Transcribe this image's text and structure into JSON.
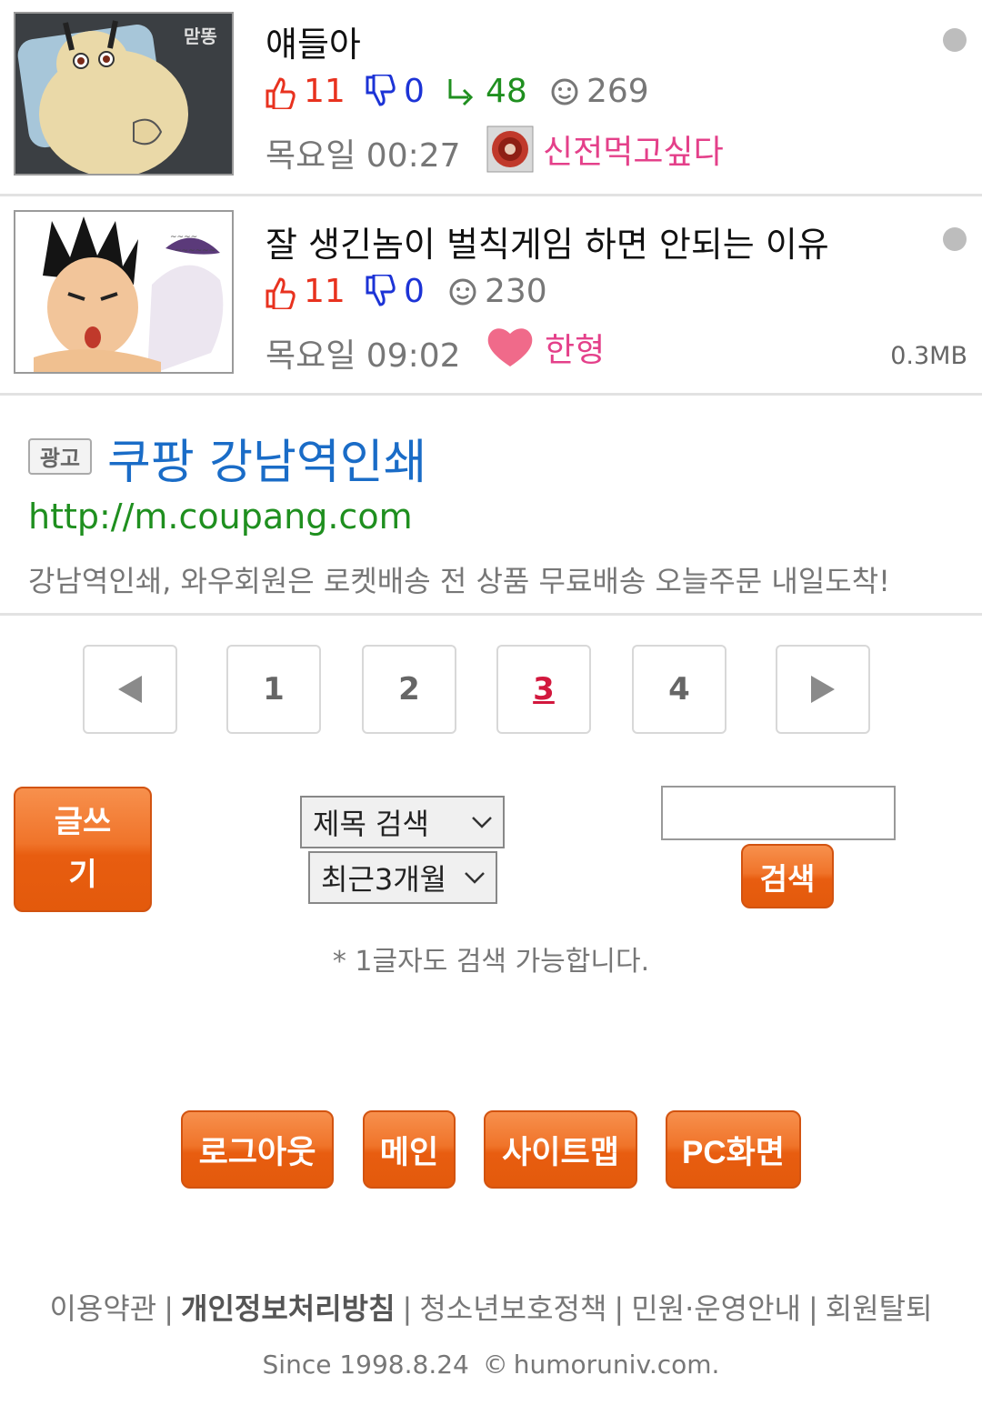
{
  "posts": [
    {
      "title": "얘들아",
      "likes": "11",
      "dislikes": "0",
      "shares": "48",
      "views": "269",
      "time": "목요일 00:27",
      "author": "신전먹고싶다",
      "thumb_text": "맏똥",
      "file_size": ""
    },
    {
      "title": "잘 생긴놈이 벌칙게임 하면 안되는 이유",
      "likes": "11",
      "dislikes": "0",
      "views": "230",
      "time": "목요일 09:02",
      "author": "한형",
      "file_size": "0.3MB"
    }
  ],
  "ad": {
    "tag": "광고",
    "title": "쿠팡 강남역인쇄",
    "url": "http://m.coupang.com",
    "description": "강남역인쇄, 와우회원은 로켓배송 전 상품 무료배송 오늘주문 내일도착!"
  },
  "pagination": {
    "pages": [
      "1",
      "2",
      "3",
      "4"
    ],
    "current": "3"
  },
  "search": {
    "write_line1": "글쓰",
    "write_line2": "기",
    "scope_select": "제목 검색",
    "period_select": "최근3개월",
    "input_value": "",
    "button": "검색",
    "hint": "* 1글자도 검색 가능합니다."
  },
  "bottom_buttons": [
    "로그아웃",
    "메인",
    "사이트맵",
    "PC화면"
  ],
  "footer": {
    "links": [
      "이용약관",
      "개인정보처리방침",
      "청소년보호정책",
      "민원·운영안내",
      "회원탈퇴"
    ],
    "since": "Since 1998.8.24",
    "site": "humoruniv.com."
  },
  "colors": {
    "like": "#e8321f",
    "dislike": "#1c33d6",
    "share": "#1f8f1f",
    "author": "#e4408a",
    "orange": "#ee6b1e",
    "ad_title": "#1a6cc7",
    "ad_url": "#1f8f1f"
  }
}
